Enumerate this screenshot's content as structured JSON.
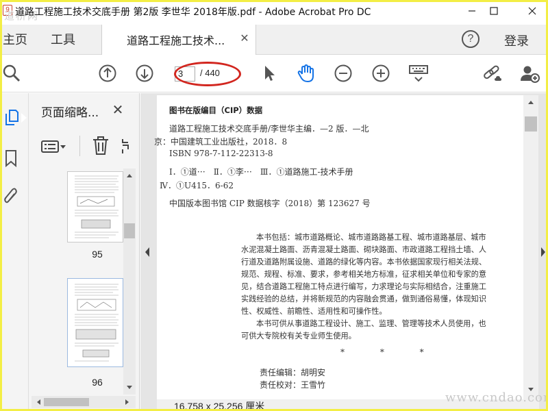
{
  "window": {
    "title": "道路工程施工技术交底手册 第2版 李世华 2018年版.pdf - Adobe Acrobat Pro DC",
    "watermark_top": "道桥网"
  },
  "tabs": {
    "home": "主页",
    "tools": "工具",
    "document": "道路工程施工技术...",
    "login": "登录"
  },
  "toolbar": {
    "current_page": "3",
    "total_pages": "/ 440"
  },
  "thumbnails": {
    "panel_title": "页面缩略...",
    "pages": [
      {
        "label": "95"
      },
      {
        "label": "96"
      }
    ]
  },
  "document": {
    "heading": "图书在版编目（CIP）数据",
    "cip_lines": [
      "道路工程施工技术交底手册/李世华主编．—2 版．—北",
      "京：中国建筑工业出版社，2018．8",
      "ISBN 978-7-112-22313-8",
      "Ⅰ．①道⋯　Ⅱ．①李⋯　Ⅲ．①道路施工-技术手册",
      "Ⅳ．①U415．6-62",
      "中国版本图书馆 CIP 数据核字（2018）第 123627 号"
    ],
    "body_lines": [
      "本书包括：城市道路概论、城市道路路基工程、城市道路基层、城市",
      "水泥混凝土路面、沥青混凝土路面、砌块路面、市政道路工程挡土墙、人",
      "行道及道路附属设施、道路的绿化等内容。本书依据国家现行相关法规、",
      "规范、规程、标准、要求，参考相关地方标准，征求相关单位和专家的意",
      "见，结合道路工程施工特点进行编写，力求理论与实际相结合，注重施工",
      "实践经验的总结，并将新规范的内容融会贯通，做到通俗易懂，体现知识",
      "性、权威性、前瞻性、适用性和可操作性。",
      "本书可供从事道路工程设计、施工、监理、管理等技术人员使用，也",
      "可供大专院校有关专业师生使用。"
    ],
    "stars": "* * *",
    "editor": "责任编辑：胡明安",
    "proof": "责任校对：王雪竹"
  },
  "status": {
    "page_size": "16.758 x 25.256 厘米"
  },
  "watermark_bottom": "www.cndao.com",
  "colors": {
    "accent_blue": "#1473e6",
    "annotation_red": "#d2261f",
    "frame_yellow": "#f3ee45"
  }
}
